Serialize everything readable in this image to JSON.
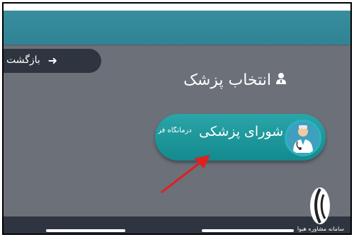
{
  "header": {
    "back_label": "بازگشت"
  },
  "main": {
    "title": "انتخاب پزشک",
    "card": {
      "title": "شورای پزشکی",
      "subtitle": "درمانگاه فر"
    }
  },
  "watermark": {
    "text": "سامانه مشاوره هیوا"
  },
  "colors": {
    "topbar": "#2f8394",
    "background": "#6b7079",
    "card": "#1a9a9e",
    "arrow": "#e02020"
  },
  "icons": {
    "back": "arrow-right-icon",
    "doctor": "doctor-icon",
    "avatar": "doctor-avatar-icon"
  }
}
